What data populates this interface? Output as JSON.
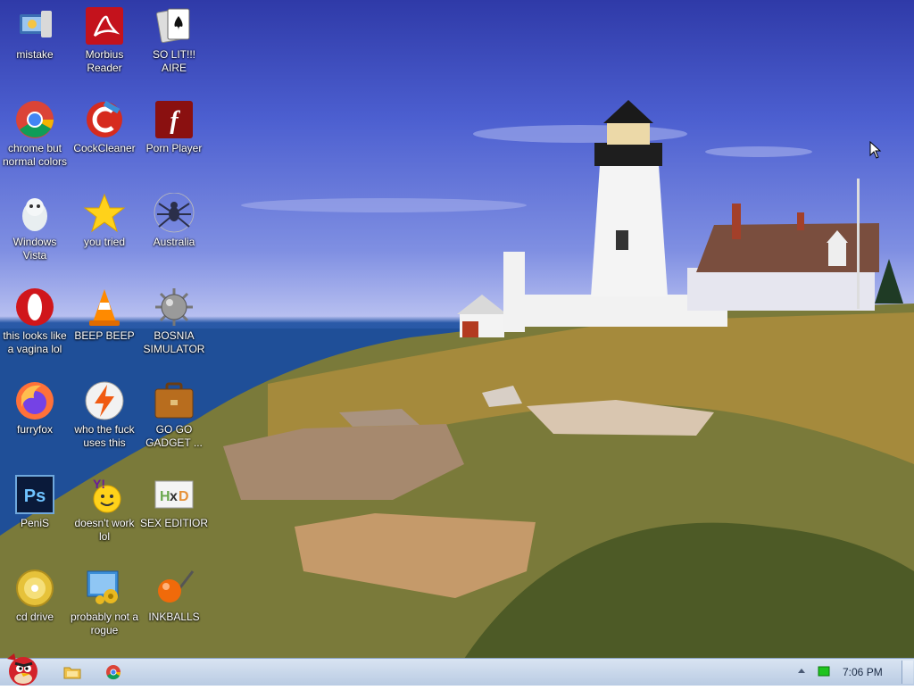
{
  "desktop": {
    "icons": [
      {
        "label": "mistake"
      },
      {
        "label": "Morbius Reader"
      },
      {
        "label": "SO LIT!!! AIRE"
      },
      {
        "label": "chrome but normal colors"
      },
      {
        "label": "CockCleaner"
      },
      {
        "label": "Porn Player"
      },
      {
        "label": "Windows Vista"
      },
      {
        "label": "you tried"
      },
      {
        "label": "Australia"
      },
      {
        "label": "this looks like a vagina lol"
      },
      {
        "label": "BEEP BEEP"
      },
      {
        "label": "BOSNIA SIMULATOR"
      },
      {
        "label": "furryfox"
      },
      {
        "label": "who the fuck uses this"
      },
      {
        "label": "GO GO GADGET ..."
      },
      {
        "label": "PeniS"
      },
      {
        "label": "doesn't work lol"
      },
      {
        "label": "SEX EDITIOR"
      },
      {
        "label": "cd drive"
      },
      {
        "label": "probably not a rogue"
      },
      {
        "label": "INKBALLS"
      }
    ]
  },
  "taskbar": {
    "clock": "7:06 PM",
    "pinned": [
      "folder-icon",
      "chrome-icon"
    ],
    "tray_icons": [
      "show-hidden-icons-arrow",
      "battery-icon"
    ]
  },
  "colors": {
    "sky_top": "#2f3aa8",
    "sea": "#1e4c92",
    "taskbar": "#c9d8ec",
    "label_text": "#ffffff"
  }
}
